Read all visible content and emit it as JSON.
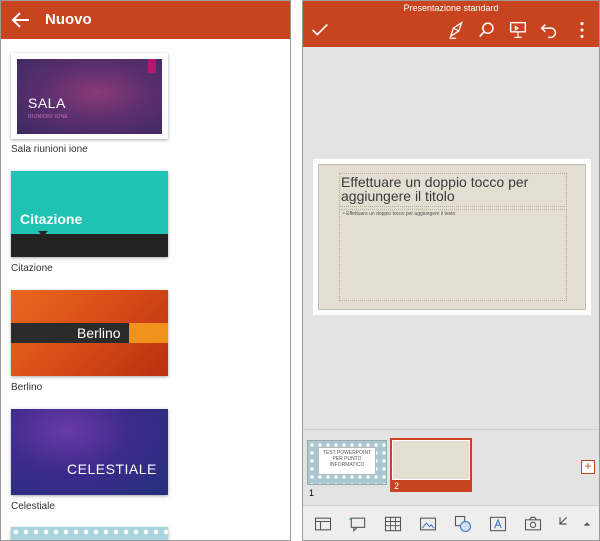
{
  "left": {
    "title": "Nuovo",
    "templates": [
      {
        "label": "Sala riunioni ione",
        "thumb_title": "SALA",
        "thumb_subtitle": "RIUNIONI IONE"
      },
      {
        "label": "Citazione",
        "thumb_title": "Citazione"
      },
      {
        "label": "Berlino",
        "thumb_title": "Berlino"
      },
      {
        "label": "Celestiale",
        "thumb_title": "CELESTIALE"
      }
    ]
  },
  "right": {
    "title": "Presentazione standard",
    "slide": {
      "title": "Effettuare un doppio tocco per aggiungere il titolo",
      "body": "• Effettuare un doppio tocco per aggiungere il testo"
    },
    "thumbnails": [
      {
        "number": "1",
        "text": "TEST POWERPOINT PER PUNTO INFORMATICO"
      },
      {
        "number": "2"
      }
    ],
    "add_slide": "+"
  },
  "colors": {
    "accent": "#c8431f",
    "canvas": "#e3e3e3",
    "slide_bg": "#e3ddd2"
  }
}
